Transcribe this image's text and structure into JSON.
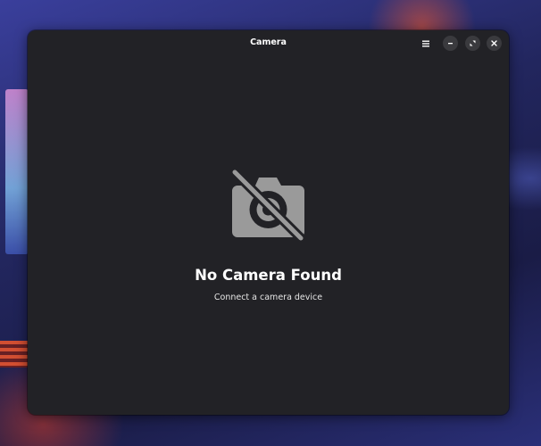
{
  "window": {
    "title": "Camera",
    "controls": {
      "menu_icon": "hamburger-menu-icon",
      "minimize_icon": "minimize-icon",
      "maximize_icon": "maximize-icon",
      "close_icon": "close-icon"
    }
  },
  "status": {
    "icon": "camera-disabled-icon",
    "title": "No Camera Found",
    "description": "Connect a camera device"
  },
  "colors": {
    "window_bg": "#222226",
    "button_bg": "#3a3a3e",
    "icon_gray": "#9a9a9a",
    "text_primary": "#ffffff"
  }
}
